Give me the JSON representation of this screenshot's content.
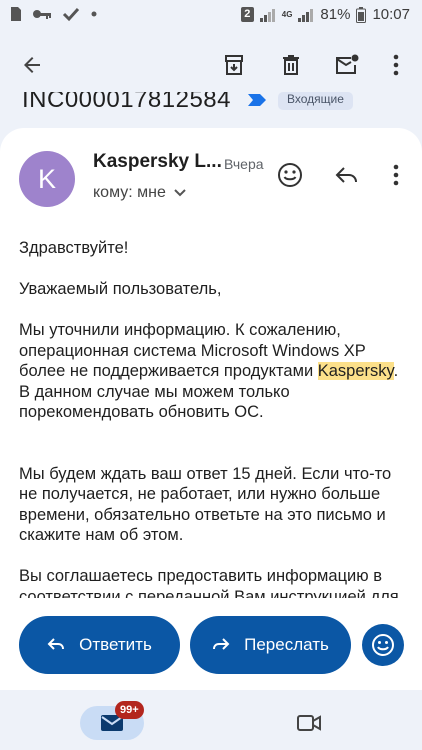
{
  "status_bar": {
    "notification_count": "2",
    "network": "4G",
    "battery": "81%",
    "time": "10:07"
  },
  "subject": {
    "text": "INC000017812584",
    "label": "Входящие"
  },
  "message": {
    "avatar_letter": "K",
    "sender": "Kaspersky L...",
    "date": "Вчера",
    "to": "кому: мне",
    "body": {
      "p1": "Здравствуйте!",
      "p2": "Уважаемый пользователь,",
      "p3_before": "Мы уточнили информацию. К сожалению, операционная система Microsoft Windows XP более не поддерживается продуктами ",
      "p3_highlight": "Kaspersky",
      "p3_after": ". В данном случае мы можем только порекомендовать обновить ОС.",
      "p4": "Мы будем ждать ваш ответ 15 дней. Если что-то не получается, не работает, или нужно больше времени, обязательно ответьте на это письмо и скажите нам об этом.",
      "p5": "Вы соглашаетесь предоставить информацию в соответствии с переданной Вам инструкцией для целей оказания поддержки. Отправляя данные"
    }
  },
  "actions": {
    "reply_label": "Ответить",
    "forward_label": "Переслать"
  },
  "bottom_nav": {
    "mail_badge": "99+"
  },
  "colors": {
    "background": "#eef2f9",
    "primary_button": "#0b57a5",
    "avatar": "#9e83cc",
    "highlight": "#fce08a",
    "badge": "#b3261e"
  },
  "icons": [
    "back-arrow-icon",
    "archive-icon",
    "delete-icon",
    "mark-unread-icon",
    "more-vert-icon",
    "emoji-icon",
    "reply-icon",
    "forward-icon",
    "mail-icon",
    "video-icon"
  ]
}
